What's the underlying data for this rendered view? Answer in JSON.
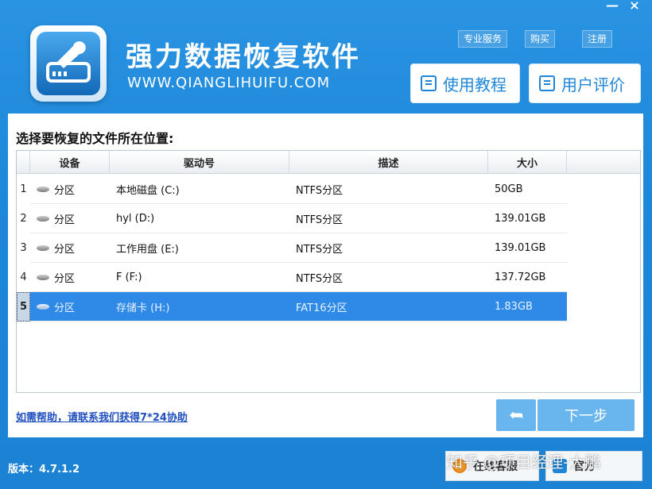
{
  "window": {
    "minimize": "—",
    "close": "×"
  },
  "app": {
    "title": "强力数据恢复软件",
    "url": "WWW.QIANGLIHUIFU.COM"
  },
  "top_links": [
    "专业服务",
    "购买",
    "注册"
  ],
  "header_buttons": {
    "tutorial": "使用教程",
    "review": "用户评价"
  },
  "panel": {
    "label": "选择要恢复的文件所在位置:"
  },
  "table": {
    "columns": [
      "设备",
      "驱动号",
      "描述",
      "大小"
    ],
    "rows": [
      {
        "num": "1",
        "device": "分区",
        "drive": "本地磁盘 (C:)",
        "desc": "NTFS分区",
        "size": "50GB"
      },
      {
        "num": "2",
        "device": "分区",
        "drive": "hyl (D:)",
        "desc": "NTFS分区",
        "size": "139.01GB"
      },
      {
        "num": "3",
        "device": "分区",
        "drive": "工作用盘 (E:)",
        "desc": "NTFS分区",
        "size": "139.01GB"
      },
      {
        "num": "4",
        "device": "分区",
        "drive": "F (F:)",
        "desc": "NTFS分区",
        "size": "137.72GB"
      },
      {
        "num": "5",
        "device": "分区",
        "drive": "存储卡 (H:)",
        "desc": "FAT16分区",
        "size": "1.83GB"
      }
    ]
  },
  "help_link": "如需帮助，请联系我们获得7*24协助",
  "buttons": {
    "back": "➦",
    "next": "下一步"
  },
  "version": "版本：4.7.1.2",
  "bottom_buttons": {
    "online": "在线客服",
    "other": "官方"
  },
  "watermark": "知乎 @项目经理-大鹏"
}
